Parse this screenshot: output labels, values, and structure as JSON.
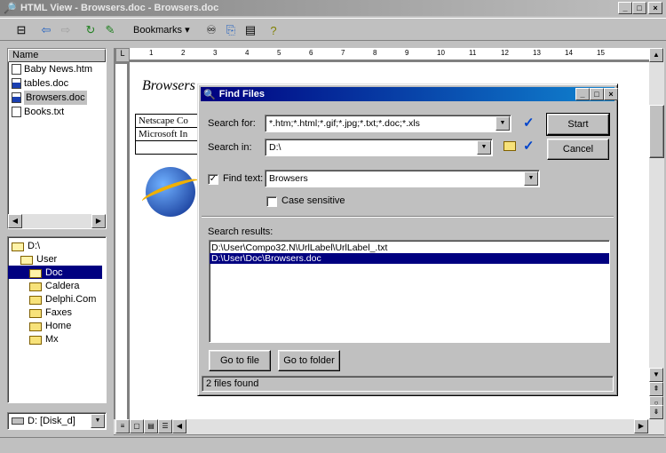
{
  "window": {
    "title": "HTML View - Browsers.doc - Browsers.doc",
    "min": "_",
    "max": "□",
    "close": "×"
  },
  "toolbar": {
    "bookmarks_label": "Bookmarks"
  },
  "files": {
    "header": "Name",
    "items": [
      {
        "name": "Baby News.htm",
        "icon": "htm-file-icon",
        "selected": false
      },
      {
        "name": "tables.doc",
        "icon": "doc-file-icon",
        "selected": false
      },
      {
        "name": "Browsers.doc",
        "icon": "doc-file-icon",
        "selected": true
      },
      {
        "name": "Books.txt",
        "icon": "txt-file-icon",
        "selected": false
      }
    ]
  },
  "tree": {
    "items": [
      {
        "label": "D:\\",
        "indent": 0,
        "open": true
      },
      {
        "label": "User",
        "indent": 1,
        "open": true
      },
      {
        "label": "Doc",
        "indent": 2,
        "open": true,
        "selected": true
      },
      {
        "label": "Caldera",
        "indent": 2
      },
      {
        "label": "Delphi.Com",
        "indent": 2
      },
      {
        "label": "Faxes",
        "indent": 2
      },
      {
        "label": "Home",
        "indent": 2
      },
      {
        "label": "Mx",
        "indent": 2
      }
    ]
  },
  "drive": {
    "label": "D: [Disk_d]"
  },
  "document": {
    "heading": "Browsers",
    "cells": [
      "Netscape Co",
      "Microsoft In"
    ]
  },
  "ruler": {
    "marks": [
      "1",
      "2",
      "3",
      "4",
      "5",
      "6",
      "7",
      "8",
      "9",
      "10",
      "11",
      "12",
      "13",
      "14",
      "15"
    ]
  },
  "dialog": {
    "title": "Find Files",
    "search_for_label": "Search for:",
    "search_for_value": "*.htm;*.html;*.gif;*.jpg;*.txt;*.doc;*.xls",
    "search_in_label": "Search in:",
    "search_in_value": "D:\\",
    "find_text_label": "Find text:",
    "find_text_checked": true,
    "find_text_value": "Browsers",
    "case_label": "Case sensitive",
    "case_checked": false,
    "results_label": "Search results:",
    "results": [
      "D:\\User\\Compo32.N\\UrlLabel\\UrlLabel_.txt",
      "D:\\User\\Doc\\Browsers.doc"
    ],
    "selected_result": 1,
    "start_label": "Start",
    "cancel_label": "Cancel",
    "goto_file_label": "Go to file",
    "goto_folder_label": "Go to folder",
    "status": "2 files found"
  }
}
